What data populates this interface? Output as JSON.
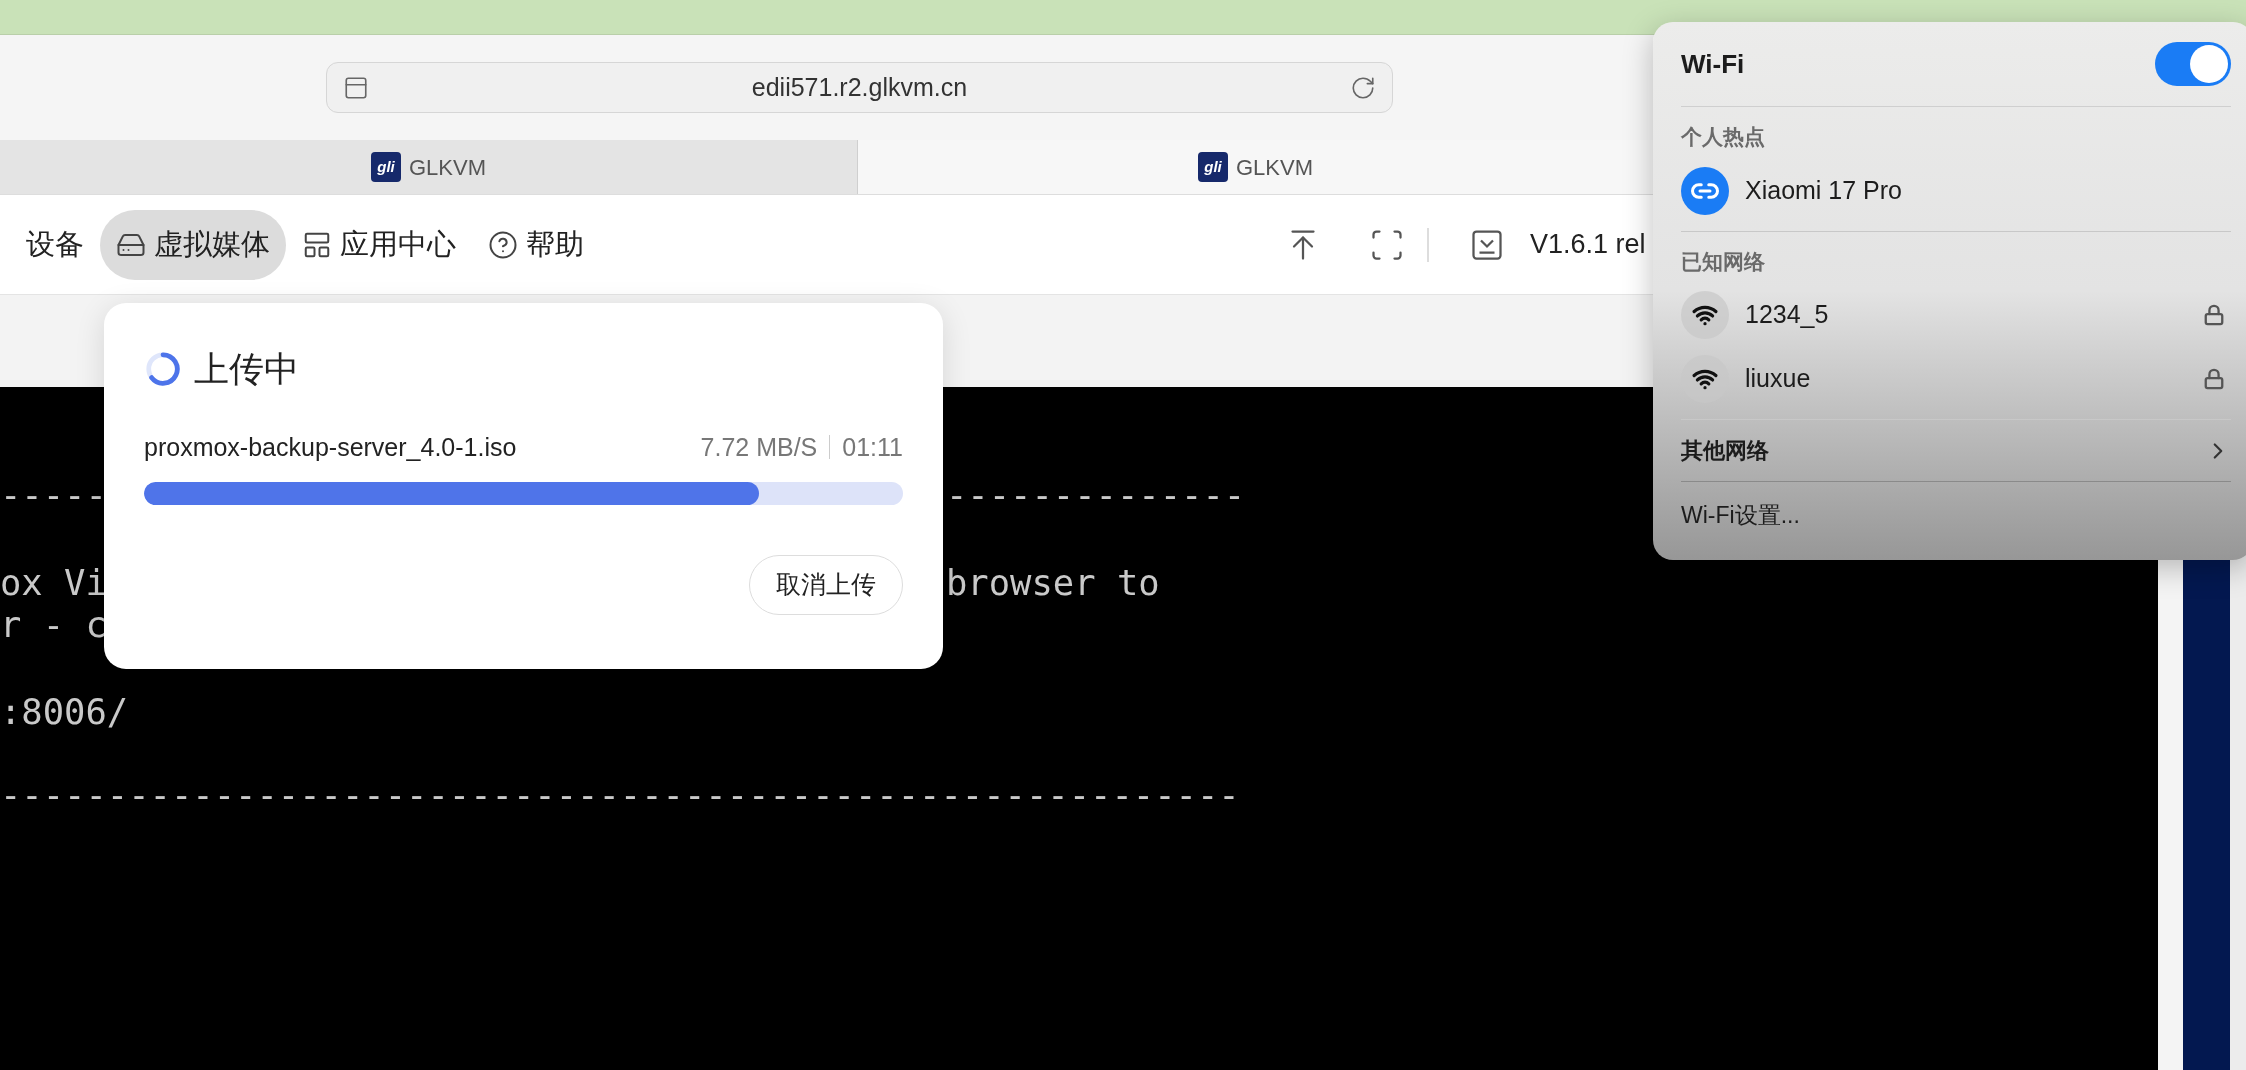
{
  "browser": {
    "address": "edii571.r2.glkvm.cn",
    "tabs": [
      {
        "badge": "gli",
        "title": "GLKVM",
        "selected": false
      },
      {
        "badge": "gli",
        "title": "GLKVM",
        "selected": true
      }
    ]
  },
  "toolbar": {
    "items": [
      {
        "label": "设备",
        "selected": false
      },
      {
        "label": "虚拟媒体",
        "selected": true
      },
      {
        "label": "应用中心",
        "selected": false
      },
      {
        "label": "帮助",
        "selected": false
      }
    ],
    "version": "V1.6.1 rel"
  },
  "terminal": {
    "lines": [
      {
        "left": "-----",
        "right": "--------------"
      },
      {
        "left": "ox Vi",
        "right": "browser to"
      },
      {
        "left": "r - c"
      },
      {
        "left": ":8006/"
      },
      {
        "left": "----------------------------------------------------------"
      }
    ]
  },
  "upload": {
    "title": "上传中",
    "file": "proxmox-backup-server_4.0-1.iso",
    "speed": "7.72 MB/S",
    "time": "01:11",
    "level": 0.81,
    "cancel": "取消上传"
  },
  "wifi": {
    "title": "Wi-Fi",
    "on": true,
    "sections": [
      {
        "heading": "个人热点",
        "networks": [
          {
            "name": "Xiaomi 17 Pro",
            "kind": "hotspot",
            "locked": false
          }
        ]
      },
      {
        "heading": "已知网络",
        "networks": [
          {
            "name": "1234_5",
            "kind": "wifi",
            "locked": true
          },
          {
            "name": "liuxue",
            "kind": "wifi",
            "locked": true
          }
        ]
      }
    ],
    "other": "其他网络",
    "settings": "Wi-Fi设置..."
  }
}
